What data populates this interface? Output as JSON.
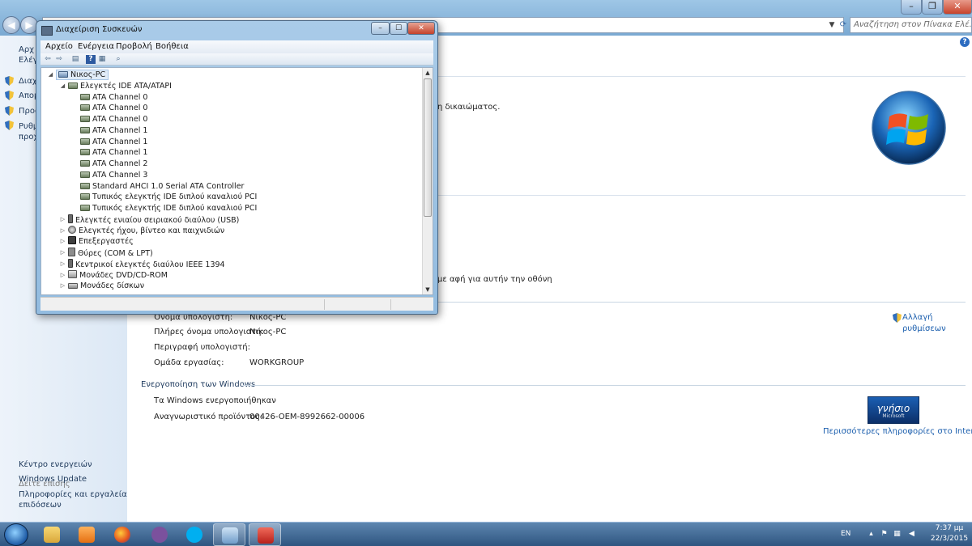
{
  "control_panel": {
    "search_placeholder": "Αναζήτηση στον Πίνακα Ελέ...",
    "left_nav": {
      "top_items": [
        "Αρχ",
        "Ελέγ"
      ],
      "shield_items": [
        "Διαχ",
        "Απομ",
        "Προσ",
        "Ρυθμ",
        "προχ"
      ],
      "see_also_title": "Δείτε επίσης",
      "see_also": [
        "Κέντρο ενεργειών",
        "Windows Update",
        "Πληροφορίες και εργαλεία",
        "επιδόσεων"
      ]
    },
    "partial_texts": [
      "η δικαιώματος.",
      "με αφή για αυτήν την οθόνη"
    ],
    "computer_info": {
      "computer_name_label": "Όνομα υπολογιστή:",
      "computer_name_value": "Νικος-PC",
      "full_name_label": "Πλήρες όνομα υπολογιστή:",
      "full_name_value": "Νικος-PC",
      "description_label": "Περιγραφή υπολογιστή:",
      "workgroup_label": "Ομάδα εργασίας:",
      "workgroup_value": "WORKGROUP",
      "change_settings": [
        "Αλλαγή",
        "ρυθμίσεων"
      ]
    },
    "activation": {
      "title": "Ενεργοποίηση των Windows",
      "status": "Τα Windows ενεργοποιήθηκαν",
      "product_id_label": "Αναγνωριστικό προϊόντος:",
      "product_id_value": "00426-OEM-8992662-00006",
      "badge": [
        "γνήσιο",
        "Microsoft"
      ],
      "more_info": "Περισσότερες πληροφορίες στο Internet..."
    }
  },
  "device_manager": {
    "title": "Διαχείριση Συσκευών",
    "menu": [
      "Αρχείο",
      "Ενέργεια",
      "Προβολή",
      "Βοήθεια"
    ],
    "root": "Νικος-PC",
    "ide_category": "Ελεγκτές IDE ATA/ATAPI",
    "ide_children": [
      "ATA Channel 0",
      "ATA Channel 0",
      "ATA Channel 0",
      "ATA Channel 1",
      "ATA Channel 1",
      "ATA Channel 1",
      "ATA Channel 2",
      "ATA Channel 3",
      "Standard AHCI 1.0 Serial ATA Controller",
      "Τυπικός ελεγκτής IDE διπλού καναλιού PCI",
      "Τυπικός ελεγκτής IDE διπλού καναλιού PCI"
    ],
    "categories": [
      {
        "label": "Ελεγκτές ενιαίου σειριακού διαύλου (USB)",
        "icon": "usb-icon"
      },
      {
        "label": "Ελεγκτές ήχου, βίντεο και παιχνιδιών",
        "icon": "speaker-icon"
      },
      {
        "label": "Επεξεργαστές",
        "icon": "processor-icon"
      },
      {
        "label": "Θύρες (COM & LPT)",
        "icon": "port-icon"
      },
      {
        "label": "Κεντρικοί ελεγκτές διαύλου IEEE 1394",
        "icon": "firewire-icon"
      },
      {
        "label": "Μονάδες DVD/CD-ROM",
        "icon": "dvd-drive-icon"
      },
      {
        "label": "Μονάδες δίσκων",
        "icon": "disk-drive-icon"
      }
    ]
  },
  "taskbar": {
    "language": "EN",
    "time": "7:37 μμ",
    "date": "22/3/2015",
    "apps": [
      "file-explorer-icon",
      "media-player-icon",
      "firefox-icon",
      "viber-icon",
      "skype-icon",
      "system-icon",
      "toolbox-icon"
    ]
  }
}
